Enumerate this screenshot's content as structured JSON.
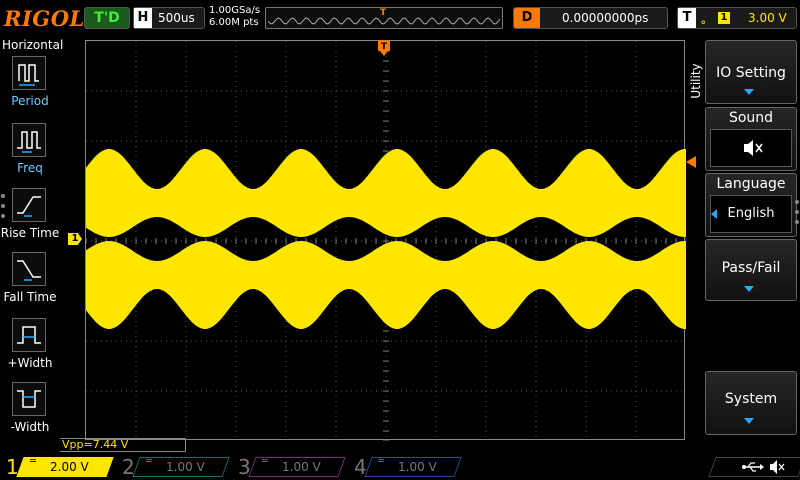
{
  "brand": "RIGOL",
  "top": {
    "trigger_status": "T'D",
    "horizontal_label": "H",
    "timebase": "500us",
    "sample_rate": "1.00GSa/s",
    "memory_depth": "6.00M pts",
    "trigger_position_marker": "T",
    "delay_label": "D",
    "delay_value": "0.00000000ps",
    "trigger_label": "T",
    "trigger_source": "1",
    "trigger_level": "3.00 V"
  },
  "left_menu": {
    "title": "Horizontal",
    "items": [
      {
        "label": "Period",
        "icon": "period-icon"
      },
      {
        "label": "Freq",
        "icon": "frequency-icon"
      },
      {
        "label": "Rise Time",
        "icon": "rise-time-icon"
      },
      {
        "label": "Fall Time",
        "icon": "fall-time-icon"
      },
      {
        "label": "+Width",
        "icon": "positive-width-icon"
      },
      {
        "label": "-Width",
        "icon": "negative-width-icon"
      }
    ]
  },
  "right_menu": {
    "tab": "Utility",
    "io_setting": "IO Setting",
    "sound_title": "Sound",
    "sound_icon": "speaker-muted-icon",
    "language_title": "Language",
    "language_value": "English",
    "pass_fail": "Pass/Fail",
    "system": "System"
  },
  "waveform": {
    "channel": "1",
    "ch1_marker": "1",
    "color": "#ffe600",
    "description_shape": "amplitude-modulated"
  },
  "measurement": {
    "vpp": "Vpp=7.44 V"
  },
  "channels": [
    {
      "num": "1",
      "scale": "2.00 V",
      "color": "#ffe600",
      "active": true
    },
    {
      "num": "2",
      "scale": "1.00 V",
      "color": "#1e6d6a",
      "active": false
    },
    {
      "num": "3",
      "scale": "1.00 V",
      "color": "#7a2a7a",
      "active": false
    },
    {
      "num": "4",
      "scale": "1.00 V",
      "color": "#2a4a9a",
      "active": false
    }
  ],
  "colors": {
    "accent": "#ff7a00",
    "ch1": "#ffe600",
    "menu_blue": "#2aa8ff",
    "trig_green": "#3cf03c"
  }
}
